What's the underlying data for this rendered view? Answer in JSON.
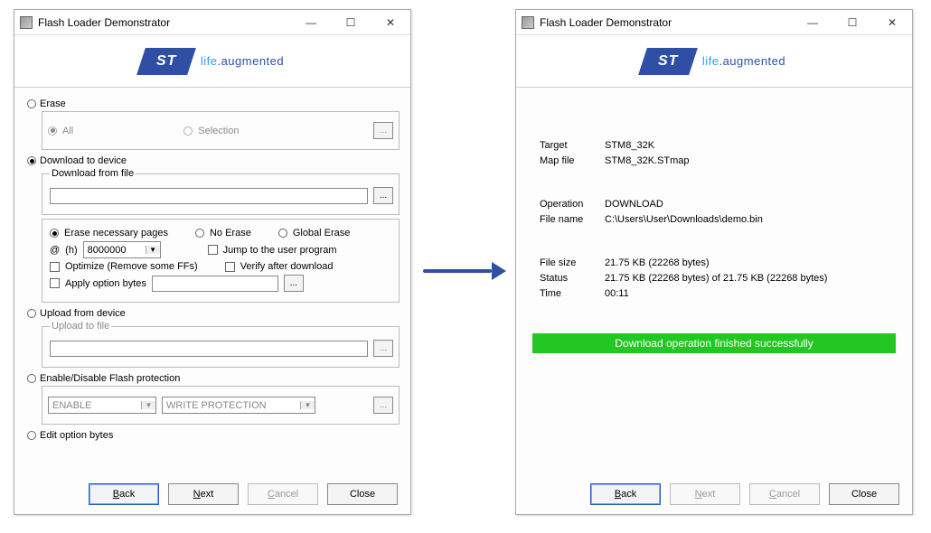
{
  "window_title": "Flash Loader Demonstrator",
  "brand": {
    "logo_text": "ST",
    "tag_prefix": "life",
    "tag_suffix": ".augmented"
  },
  "left": {
    "erase": {
      "label": "Erase",
      "all": "All",
      "selection": "Selection"
    },
    "download": {
      "label": "Download to device",
      "from_file_legend": "Download from file",
      "file_value": "",
      "erase_necessary": "Erase necessary pages",
      "no_erase": "No Erase",
      "global_erase": "Global Erase",
      "addr_prefix": "@",
      "addr_h": "(h)",
      "addr_value": "8000000",
      "jump": "Jump to the user program",
      "optimize": "Optimize (Remove some FFs)",
      "verify": "Verify after download",
      "apply_opt": "Apply option bytes",
      "apply_opt_value": ""
    },
    "upload": {
      "label": "Upload from device",
      "legend": "Upload to file",
      "value": ""
    },
    "protection": {
      "label": "Enable/Disable Flash protection",
      "enable": "ENABLE",
      "type": "WRITE PROTECTION"
    },
    "edit_opt": "Edit option bytes"
  },
  "right": {
    "target_label": "Target",
    "target_value": "STM8_32K",
    "map_label": "Map file",
    "map_value": "STM8_32K.STmap",
    "op_label": "Operation",
    "op_value": "DOWNLOAD",
    "fn_label": "File name",
    "fn_value": "C:\\Users\\User\\Downloads\\demo.bin",
    "size_label": "File size",
    "size_value": "21.75 KB (22268 bytes)",
    "status_label": "Status",
    "status_value": "21.75 KB (22268 bytes) of 21.75 KB (22268 bytes)",
    "time_label": "Time",
    "time_value": "00:11",
    "success": "Download operation finished successfully"
  },
  "buttons": {
    "back": "Back",
    "next": "Next",
    "cancel": "Cancel",
    "close": "Close"
  },
  "glyphs": {
    "underscore_letter_b": "B",
    "underscore_letter_n": "N",
    "underscore_letter_c": "C",
    "ellipsis": "..."
  }
}
